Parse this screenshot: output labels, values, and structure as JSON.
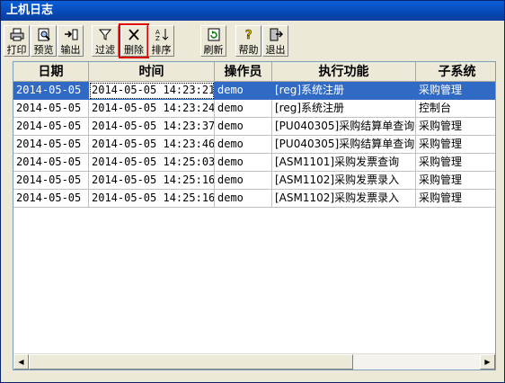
{
  "window": {
    "title": "上机日志"
  },
  "toolbar": {
    "buttons": [
      {
        "label": "打印",
        "icon": "printer-icon"
      },
      {
        "label": "预览",
        "icon": "preview-icon"
      },
      {
        "label": "输出",
        "icon": "export-icon"
      },
      {
        "label": "过滤",
        "icon": "filter-icon"
      },
      {
        "label": "删除",
        "icon": "delete-icon"
      },
      {
        "label": "排序",
        "icon": "sort-icon"
      },
      {
        "label": "刷新",
        "icon": "refresh-icon"
      },
      {
        "label": "帮助",
        "icon": "help-icon"
      },
      {
        "label": "退出",
        "icon": "exit-icon"
      }
    ]
  },
  "grid": {
    "columns": [
      "日期",
      "时间",
      "操作员",
      "执行功能",
      "子系统"
    ],
    "rows": [
      [
        "2014-05-05",
        "2014-05-05 14:23:21",
        "demo",
        "[reg]系统注册",
        "采购管理"
      ],
      [
        "2014-05-05",
        "2014-05-05 14:23:24",
        "demo",
        "[reg]系统注册",
        "控制台"
      ],
      [
        "2014-05-05",
        "2014-05-05 14:23:37",
        "demo",
        "[PU040305]采购结算单查询",
        "采购管理"
      ],
      [
        "2014-05-05",
        "2014-05-05 14:23:46",
        "demo",
        "[PU040305]采购结算单查询",
        "采购管理"
      ],
      [
        "2014-05-05",
        "2014-05-05 14:25:03",
        "demo",
        "[ASM1101]采购发票查询",
        "采购管理"
      ],
      [
        "2014-05-05",
        "2014-05-05 14:25:16",
        "demo",
        "[ASM1102]采购发票录入",
        "采购管理"
      ],
      [
        "2014-05-05",
        "2014-05-05 14:25:16",
        "demo",
        "[ASM1102]采购发票录入",
        "采购管理"
      ]
    ],
    "selected_row": 0
  },
  "colors": {
    "selection": "#316ac5",
    "highlight_border": "#e00000",
    "titlebar": "#0a5fd8"
  }
}
